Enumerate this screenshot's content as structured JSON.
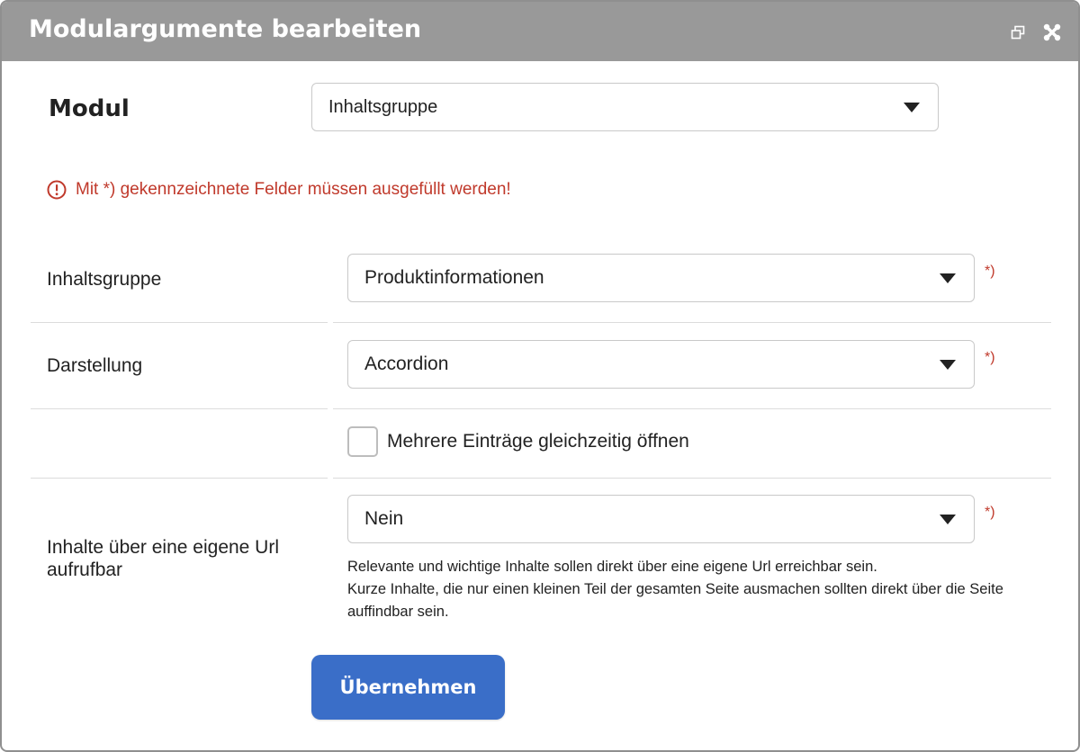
{
  "window": {
    "title": "Modulargumente bearbeiten",
    "restore_icon": "restore-window-icon",
    "close_icon": "close-icon"
  },
  "modul": {
    "label": "Modul",
    "selected": "Inhaltsgruppe"
  },
  "notice": {
    "icon": "warning-circle-icon",
    "text": "Mit *) gekennzeichnete Felder müssen ausgefüllt werden!",
    "color": "#c0392b"
  },
  "fields": {
    "inhaltsgruppe": {
      "label": "Inhaltsgruppe",
      "selected": "Produktinformationen",
      "required_mark": "*)"
    },
    "darstellung": {
      "label": "Darstellung",
      "selected": "Accordion",
      "required_mark": "*)"
    },
    "mehrere": {
      "label": "Mehrere Einträge gleichzeitig öffnen",
      "checked": false
    },
    "url": {
      "label": "Inhalte über eine eigene Url aufrufbar",
      "selected": "Nein",
      "required_mark": "*)",
      "help_line1": "Relevante und wichtige Inhalte sollen direkt über eine eigene Url erreichbar sein.",
      "help_line2": "Kurze Inhalte, die nur einen kleinen Teil der gesamten Seite ausmachen sollten direkt über die Seite auffindbar sein."
    }
  },
  "actions": {
    "submit_label": "Übernehmen",
    "submit_color": "#3a6ec8"
  },
  "colors": {
    "titlebar": "#999999",
    "required": "#c0392b"
  }
}
